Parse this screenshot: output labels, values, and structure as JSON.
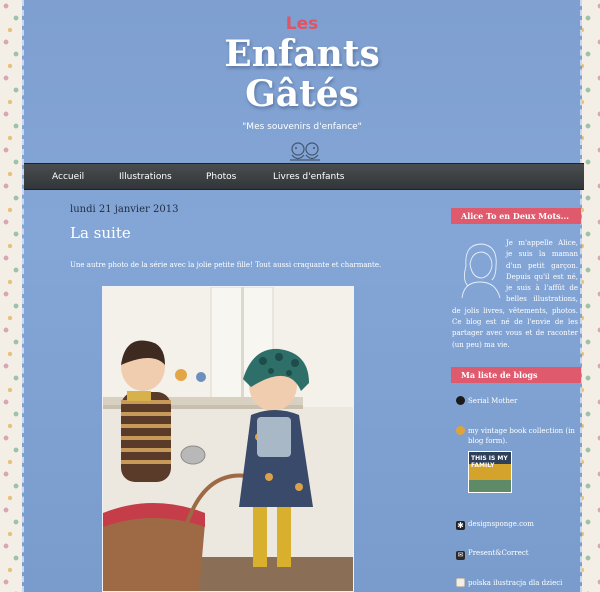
{
  "header": {
    "brand_prefix": "Les",
    "brand_title_line1": "Enfants",
    "brand_title_line2": "Gâtés",
    "tagline": "\"Mes souvenirs d'enfance\""
  },
  "nav": {
    "items": [
      {
        "label": "Accueil"
      },
      {
        "label": "Illustrations"
      },
      {
        "label": "Photos"
      },
      {
        "label": "Livres d'enfants"
      }
    ]
  },
  "post": {
    "date": "lundi 21 janvier 2013",
    "title": "La suite",
    "text": "Une autre photo de la série avec la jolie petite fille! Tout aussi craquante et charmante."
  },
  "sidebar": {
    "about": {
      "title": "Alice To en Deux Mots...",
      "text": "Je m'appelle Alice, je suis la maman d'un petit garçon. Depuis qu'il est né, je suis à l'affût de belles illustrations, de jolis livres, vêtements, photos. Ce blog est né de l'envie de les partager avec vous et de raconter (un peu) ma vie."
    },
    "blogs": {
      "title": "Ma liste de blogs",
      "items": [
        {
          "label": "Serial Mother",
          "icon": "blog-favicon"
        },
        {
          "label": "my vintage book collection (in blog form).",
          "icon": "blog-favicon"
        },
        {
          "label": "designsponge.com",
          "icon": "asterisk-icon"
        },
        {
          "label": "Present&Correct",
          "icon": "envelope-icon"
        },
        {
          "label": "polska ilustracja dla dzieci",
          "icon": "blog-favicon"
        }
      ],
      "thumb_text": "THIS IS MY FAMILY"
    }
  },
  "colors": {
    "panel": "#84a6d6",
    "accent": "#e05a6e",
    "nav": "#3a3d40"
  }
}
